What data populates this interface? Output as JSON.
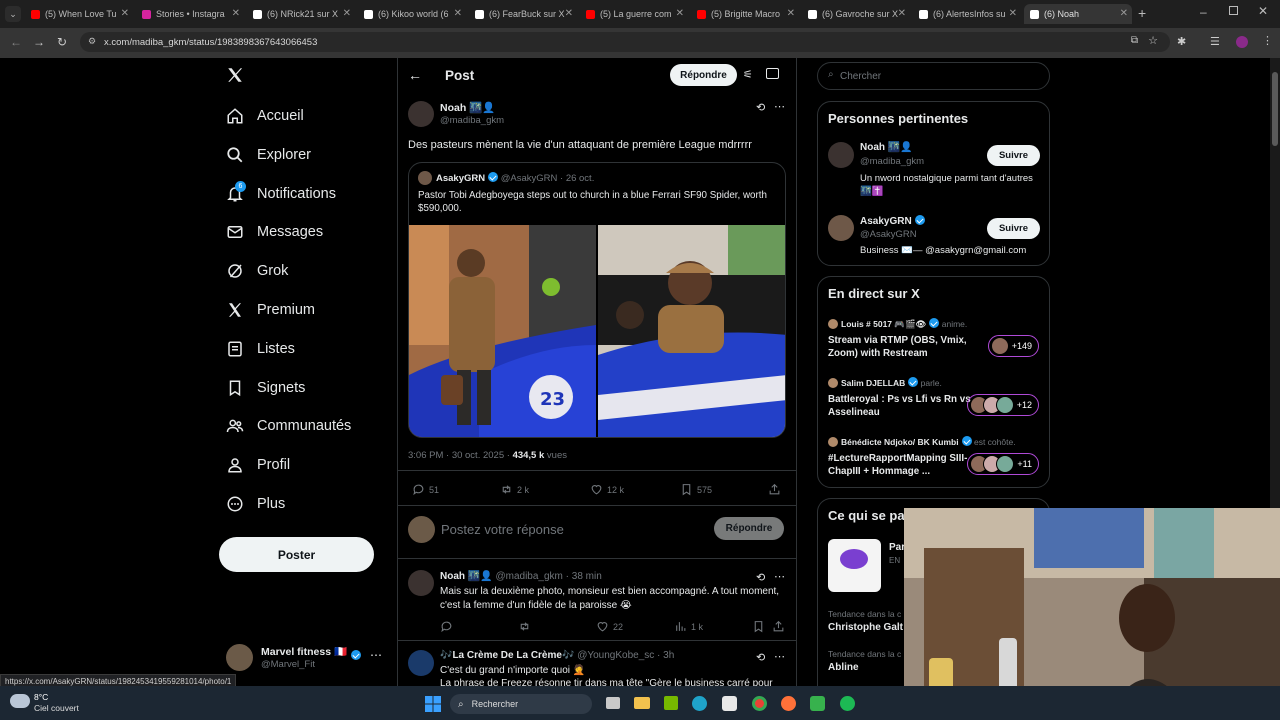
{
  "browser": {
    "tabs": [
      {
        "title": "(5) When Love Tu",
        "color": "#ff0000"
      },
      {
        "title": "Stories • Instagra",
        "color": "#d6249f"
      },
      {
        "title": "(6) NRick21 sur X",
        "color": "#ffffff"
      },
      {
        "title": "(6) Kikoo world (6",
        "color": "#ffffff"
      },
      {
        "title": "(6) FearBuck sur X",
        "color": "#ffffff"
      },
      {
        "title": "(5) La guerre com",
        "color": "#ff0000"
      },
      {
        "title": "(5) Brigitte Macro",
        "color": "#ff0000"
      },
      {
        "title": "(6) Gavroche sur X",
        "color": "#ffffff"
      },
      {
        "title": "(6) AlertesInfos su",
        "color": "#ffffff"
      },
      {
        "title": "(6) Noah",
        "color": "#ffffff"
      }
    ],
    "url": "x.com/madiba_gkm/status/1983898367643066453",
    "status_url": "https://x.com/AsakyGRN/status/1982453419559281014/photo/1"
  },
  "nav": {
    "items": [
      {
        "label": "Accueil",
        "icon": "home-icon"
      },
      {
        "label": "Explorer",
        "icon": "search-icon"
      },
      {
        "label": "Notifications",
        "icon": "bell-icon",
        "badge": "6"
      },
      {
        "label": "Messages",
        "icon": "envelope-icon"
      },
      {
        "label": "Grok",
        "icon": "grok-icon"
      },
      {
        "label": "Premium",
        "icon": "x-logo-icon"
      },
      {
        "label": "Listes",
        "icon": "list-icon"
      },
      {
        "label": "Signets",
        "icon": "bookmark-icon"
      },
      {
        "label": "Communautés",
        "icon": "people-icon"
      },
      {
        "label": "Profil",
        "icon": "person-icon"
      },
      {
        "label": "Plus",
        "icon": "more-circle-icon"
      }
    ],
    "post_button": "Poster",
    "account": {
      "name": "Marvel fitness 🇫🇷",
      "handle": "@Marvel_Fit"
    }
  },
  "post": {
    "header_title": "Post",
    "reply_button": "Répondre",
    "author_name": "Noah 🌃👤",
    "author_handle": "@madiba_gkm",
    "text": "Des pasteurs mènent la vie d'un attaquant de première League mdrrrrr",
    "quote": {
      "name": "AsakyGRN",
      "handle": "@AsakyGRN",
      "date": "· 26 oct.",
      "text": "Pastor Tobi Adegboyega steps out to church in a blue Ferrari SF90 Spider, worth $590,000."
    },
    "time": "3:06 PM · 30 oct. 2025 ·",
    "views_count": "434,5 k",
    "views_label": "vues",
    "stats": {
      "replies": "51",
      "reposts": "2 k",
      "likes": "12 k",
      "bookmarks": "575"
    },
    "reply_placeholder": "Postez votre réponse",
    "reply_submit": "Répondre"
  },
  "replies": [
    {
      "name": "Noah 🌃👤",
      "handle": "@madiba_gkm · 38 min",
      "text": "Mais sur la deuxième photo, monsieur est bien accompagné. A tout moment, c'est la femme d'un fidèle de la paroisse 😭",
      "stats": {
        "replies": "",
        "reposts": "",
        "likes": "22",
        "views": "1 k"
      }
    },
    {
      "name": "🎶La Crème De La Crème🎶",
      "handle": "@YoungKobe_sc · 3h",
      "text": "C'est du grand n'importe quoi 🤦",
      "text2": "La phrase de Freeze résonne tir dans ma tête \"Gère le business carré pour"
    }
  ],
  "search": {
    "placeholder": "Chercher"
  },
  "relevant": {
    "title": "Personnes pertinentes",
    "people": [
      {
        "name": "Noah 🌃👤",
        "handle": "@madiba_gkm",
        "bio": "Un nword nostalgique parmi tant d'autres 🌃✝️",
        "button": "Suivre"
      },
      {
        "name": "AsakyGRN",
        "handle": "@AsakyGRN",
        "bio": "Business ✉️— @asakygrn@gmail.com",
        "button": "Suivre"
      }
    ]
  },
  "live": {
    "title": "En direct sur X",
    "items": [
      {
        "host": "Louis # 5017 🎮🎬👁",
        "role": "anime.",
        "title": "Stream via RTMP (OBS, Vmix, Zoom) with Restream",
        "count": "+149"
      },
      {
        "host": "Salim DJELLAB",
        "role": "parle.",
        "title": "Battleroyal : Ps vs Lfi vs Rn vs Asselineau",
        "count": "+12"
      },
      {
        "host": "Bénédicte Ndjoko/ BK Kumbi",
        "role": "est cohôte.",
        "title": "#LectureRapportMapping SIII-ChapIII + Hommage ...",
        "count": "+11"
      }
    ]
  },
  "happening": {
    "title": "Ce qui se pa",
    "event_title": "Par",
    "event_sub": "EN",
    "trend1_context": "Tendance dans la c",
    "trend1_name": "Christophe Galt",
    "trend2_context": "Tendance dans la c",
    "trend2_name": "Abline"
  },
  "taskbar": {
    "weather_temp": "8°C",
    "weather_desc": "Ciel couvert",
    "search": "Rechercher"
  }
}
